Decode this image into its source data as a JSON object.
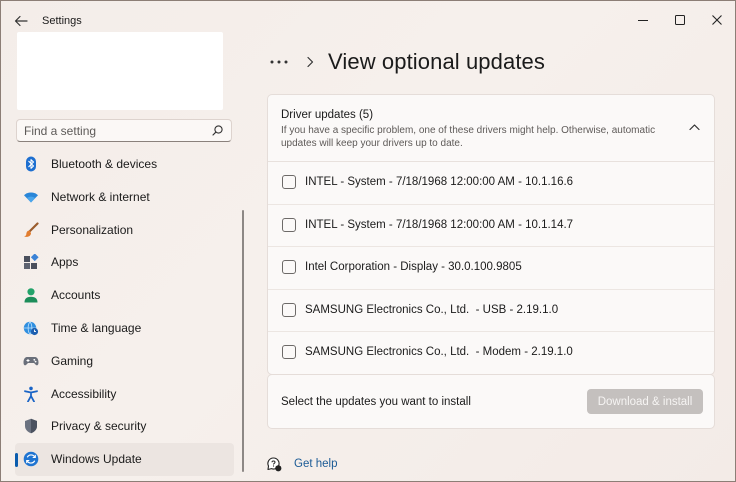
{
  "window": {
    "title": "Settings",
    "colors": {
      "accent": "#0b5cad",
      "link": "#1b5a95"
    }
  },
  "sidebar": {
    "search": {
      "placeholder": "Find a setting",
      "value": ""
    },
    "items": [
      {
        "label": "Bluetooth & devices",
        "icon": "bluetooth-icon",
        "active": false
      },
      {
        "label": "Network & internet",
        "icon": "wifi-icon",
        "active": false
      },
      {
        "label": "Personalization",
        "icon": "brush-icon",
        "active": false
      },
      {
        "label": "Apps",
        "icon": "apps-icon",
        "active": false
      },
      {
        "label": "Accounts",
        "icon": "person-icon",
        "active": false
      },
      {
        "label": "Time & language",
        "icon": "globe-clock-icon",
        "active": false
      },
      {
        "label": "Gaming",
        "icon": "gamepad-icon",
        "active": false
      },
      {
        "label": "Accessibility",
        "icon": "accessibility-icon",
        "active": false
      },
      {
        "label": "Privacy & security",
        "icon": "shield-icon",
        "active": false
      },
      {
        "label": "Windows Update",
        "icon": "windows-update-icon",
        "active": true
      }
    ]
  },
  "main": {
    "breadcrumb_more": "•••",
    "page_title": "View optional updates",
    "driver_updates": {
      "title": "Driver updates (5)",
      "description": "If you have a specific problem, one of these drivers might help. Otherwise, automatic updates will keep your drivers up to date.",
      "items": [
        {
          "label": "INTEL - System - 7/18/1968 12:00:00 AM - 10.1.16.6",
          "checked": false
        },
        {
          "label": "INTEL - System - 7/18/1968 12:00:00 AM - 10.1.14.7",
          "checked": false
        },
        {
          "label": "Intel Corporation - Display - 30.0.100.9805",
          "checked": false
        },
        {
          "label": "SAMSUNG Electronics Co., Ltd.  - USB - 2.19.1.0",
          "checked": false
        },
        {
          "label": "SAMSUNG Electronics Co., Ltd.  - Modem - 2.19.1.0",
          "checked": false
        }
      ]
    },
    "install": {
      "text": "Select the updates you want to install",
      "button_label": "Download & install"
    },
    "help": {
      "label": "Get help"
    }
  }
}
